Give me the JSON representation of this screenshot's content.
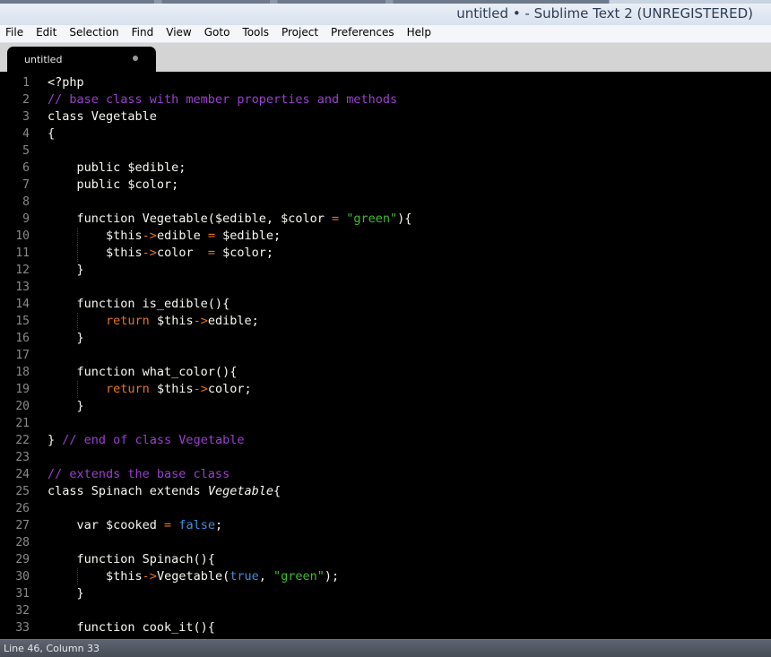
{
  "window": {
    "title": "untitled • - Sublime Text 2 (UNREGISTERED)"
  },
  "menu": [
    "File",
    "Edit",
    "Selection",
    "Find",
    "View",
    "Goto",
    "Tools",
    "Project",
    "Preferences",
    "Help"
  ],
  "tab": {
    "label": "untitled"
  },
  "status": {
    "text": "Line 46, Column 33"
  },
  "colors": {
    "comment": "#9b3fd1",
    "keyword": "#e8731a",
    "string": "#3fbf2d",
    "builtin": "#3f8fde",
    "text": "#f8f8f2",
    "background": "#000000"
  },
  "code": {
    "line_numbers": [
      "1",
      "2",
      "3",
      "4",
      "5",
      "6",
      "7",
      "8",
      "9",
      "10",
      "11",
      "12",
      "13",
      "14",
      "15",
      "16",
      "17",
      "18",
      "19",
      "20",
      "21",
      "22",
      "23",
      "24",
      "25",
      "26",
      "27",
      "28",
      "29",
      "30",
      "31",
      "32",
      "33"
    ],
    "lines": [
      "<?php",
      "// base class with member properties and methods",
      "class Vegetable",
      "{",
      "",
      "    public $edible;",
      "    public $color;",
      "",
      "    function Vegetable($edible, $color = \"green\"){",
      "        $this->edible = $edible;",
      "        $this->color  = $color;",
      "    }",
      "",
      "    function is_edible(){",
      "        return $this->edible;",
      "    }",
      "",
      "    function what_color(){",
      "        return $this->color;",
      "    }",
      "",
      "} // end of class Vegetable",
      "",
      "// extends the base class",
      "class Spinach extends Vegetable{",
      "",
      "    var $cooked = false;",
      "",
      "    function Spinach(){",
      "        $this->Vegetable(true, \"green\");",
      "    }",
      "",
      "    function cook_it(){"
    ]
  }
}
